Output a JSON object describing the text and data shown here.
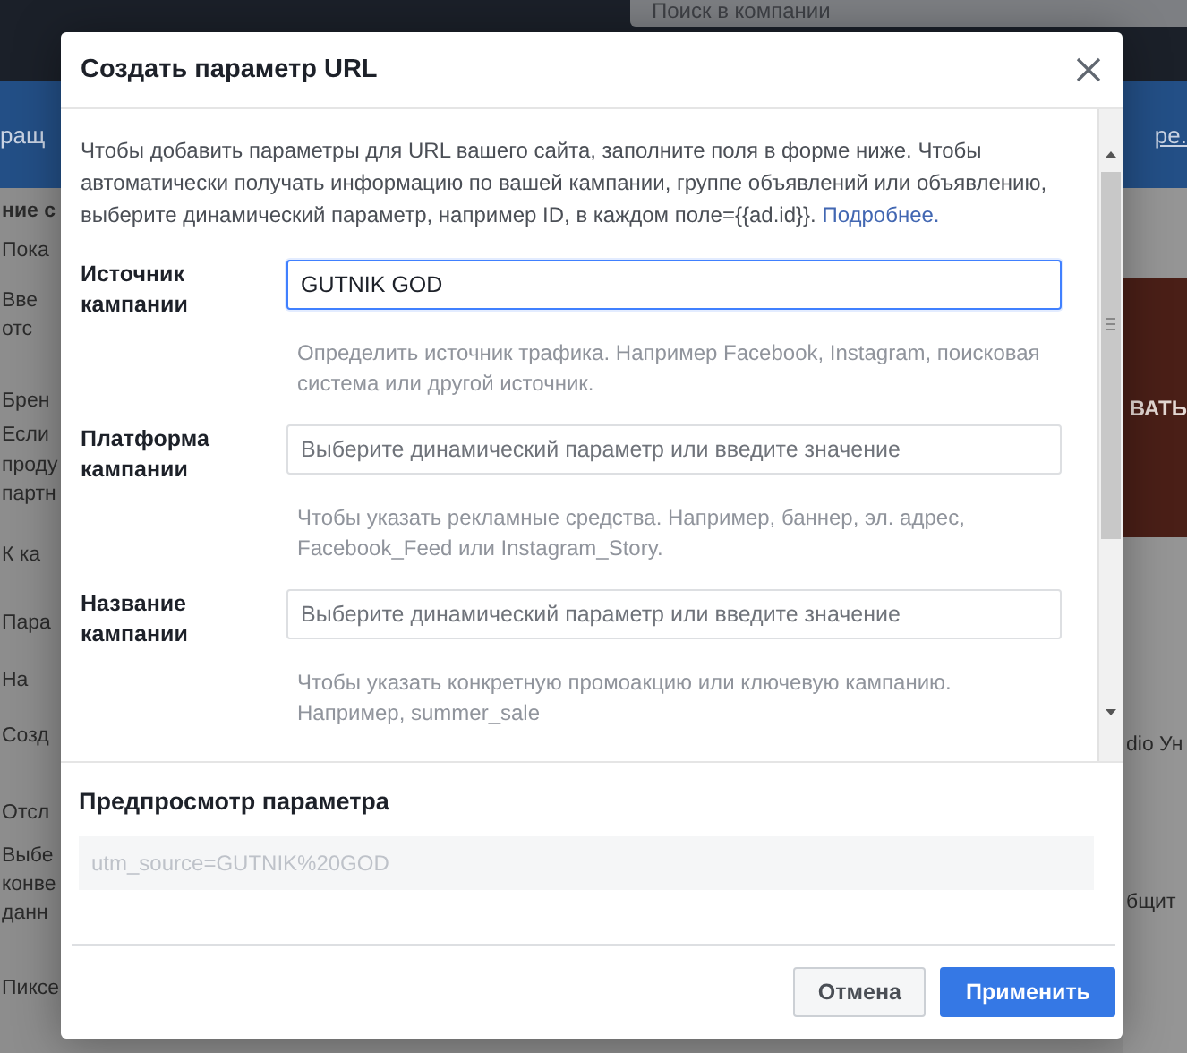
{
  "background": {
    "search": {
      "placeholder": "Поиск в компании"
    },
    "banner_left": "ращ",
    "banner_right": "ре.",
    "left_fragments": [
      "ние с",
      "Пока",
      "Вве",
      "отс",
      "Брен",
      "Если",
      "проду",
      "партн",
      "К ка",
      "Пара",
      "На",
      "Созд",
      "Отсл",
      "Выбе",
      "конве",
      "данн",
      "Пиксе"
    ],
    "image_text": "ВАТЬ",
    "right_fragments": [
      "dio Ун",
      "бщит"
    ]
  },
  "dialog": {
    "title": "Создать параметр URL",
    "intro": "Чтобы добавить параметры для URL вашего сайта, заполните поля в форме ниже. Чтобы автоматически получать информацию по вашей кампании, группе объявлений или объявлению, выберите динамический параметр, например ID, в каждом поле={{ad.id}}.",
    "intro_link": "Подробнее.",
    "fields": [
      {
        "label": "Источник кампании",
        "value": "GUTNIK GOD",
        "focused": true,
        "hint": "Определить источник трафика. Например Facebook, Instagram, поисковая система или другой источник."
      },
      {
        "label": "Платформа кампании",
        "placeholder": "Выберите динамический параметр или введите значение",
        "focused": false,
        "hint": "Чтобы указать рекламные средства. Например, баннер, эл. адрес, Facebook_Feed или Instagram_Story."
      },
      {
        "label": "Название кампании",
        "placeholder": "Выберите динамический параметр или введите значение",
        "focused": false,
        "hint": "Чтобы указать конкретную промоакцию или ключевую кампанию. Например, summer_sale"
      }
    ],
    "preview": {
      "title": "Предпросмотр параметра",
      "value": "utm_source=GUTNIK%20GOD"
    },
    "buttons": [
      {
        "label": "Отмена",
        "kind": "secondary"
      },
      {
        "label": "Применить",
        "kind": "primary"
      }
    ]
  }
}
